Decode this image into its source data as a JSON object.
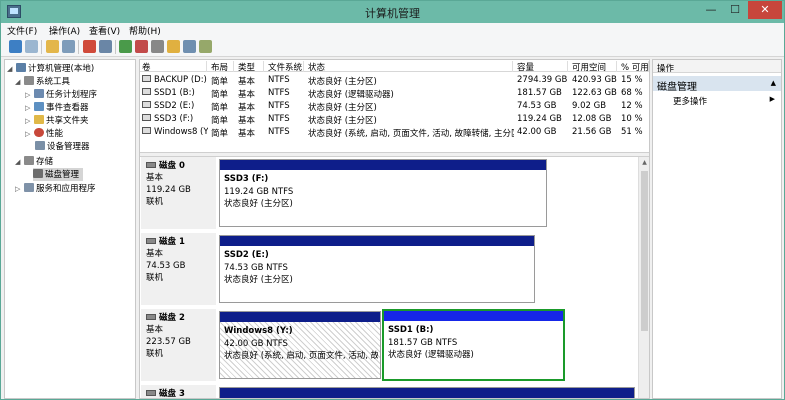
{
  "window": {
    "title": "计算机管理"
  },
  "titlebar_buttons": {
    "minimize": "—",
    "maximize": "☐",
    "close": "✕"
  },
  "menu": [
    "文件(F)",
    "操作(A)",
    "查看(V)",
    "帮助(H)"
  ],
  "tree": {
    "root": "计算机管理(本地)",
    "system_tools": "系统工具",
    "task_scheduler": "任务计划程序",
    "event_viewer": "事件查看器",
    "shared_folders": "共享文件夹",
    "performance": "性能",
    "device_manager": "设备管理器",
    "storage": "存储",
    "disk_management": "磁盘管理",
    "services_apps": "服务和应用程序"
  },
  "volume_list": {
    "headers": [
      "卷",
      "布局",
      "类型",
      "文件系统",
      "状态",
      "容量",
      "可用空间",
      "% 可用"
    ],
    "rows": [
      [
        "BACKUP (D:)",
        "简单",
        "基本",
        "NTFS",
        "状态良好 (主分区)",
        "2794.39 GB",
        "420.93 GB",
        "15 %"
      ],
      [
        "SSD1 (B:)",
        "简单",
        "基本",
        "NTFS",
        "状态良好 (逻辑驱动器)",
        "181.57 GB",
        "122.63 GB",
        "68 %"
      ],
      [
        "SSD2 (E:)",
        "简单",
        "基本",
        "NTFS",
        "状态良好 (主分区)",
        "74.53 GB",
        "9.02 GB",
        "12 %"
      ],
      [
        "SSD3 (F:)",
        "简单",
        "基本",
        "NTFS",
        "状态良好 (主分区)",
        "119.24 GB",
        "12.08 GB",
        "10 %"
      ],
      [
        "Windows8 (Y:)",
        "简单",
        "基本",
        "NTFS",
        "状态良好 (系统, 启动, 页面文件, 活动, 故障转储, 主分区)",
        "42.00 GB",
        "21.56 GB",
        "51 %"
      ]
    ]
  },
  "disks": [
    {
      "name": "磁盘 0",
      "type": "基本",
      "size": "119.24 GB",
      "status": "联机",
      "partitions": [
        {
          "name": "SSD3 (F:)",
          "size": "119.24 GB NTFS",
          "status": "状态良好 (主分区)"
        }
      ]
    },
    {
      "name": "磁盘 1",
      "type": "基本",
      "size": "74.53 GB",
      "status": "联机",
      "partitions": [
        {
          "name": "SSD2 (E:)",
          "size": "74.53 GB NTFS",
          "status": "状态良好 (主分区)"
        }
      ]
    },
    {
      "name": "磁盘 2",
      "type": "基本",
      "size": "223.57 GB",
      "status": "联机",
      "partitions": [
        {
          "name": "Windows8 (Y:)",
          "size": "42.00 GB NTFS",
          "status": "状态良好 (系统, 启动, 页面文件, 活动, 故障转储"
        },
        {
          "name": "SSD1 (B:)",
          "size": "181.57 GB NTFS",
          "status": "状态良好 (逻辑驱动器)"
        }
      ]
    },
    {
      "name": "磁盘 3",
      "type": "",
      "size": "",
      "status": "",
      "partitions": []
    }
  ],
  "actions": {
    "header": "操作",
    "section": "磁盘管理",
    "more": "更多操作"
  },
  "colors": {
    "titlebar": "#6cbaa8",
    "partition_bar": "#0e1e8a",
    "selected_partition": "#1a9a2a",
    "action_section": "#d9e4ef"
  }
}
